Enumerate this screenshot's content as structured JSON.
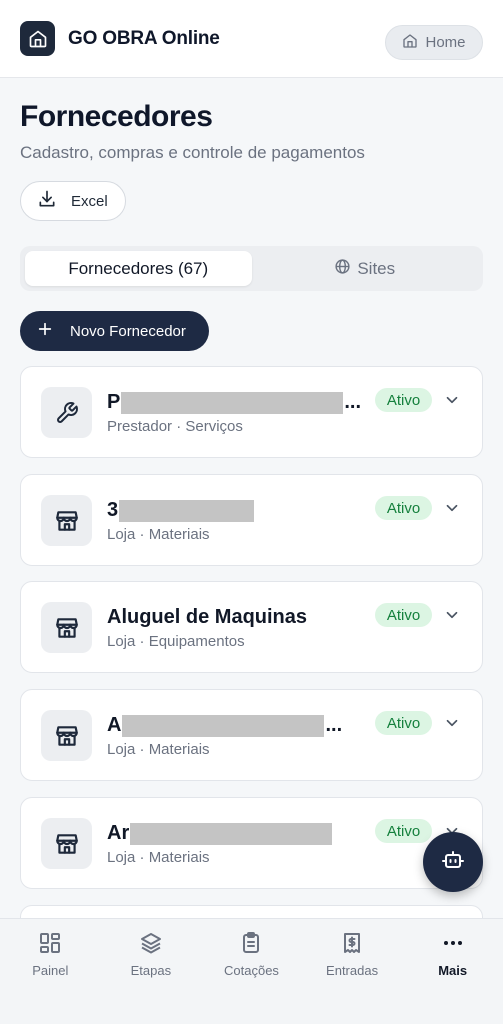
{
  "app": {
    "title": "GO OBRA Online"
  },
  "header": {
    "home_label": "Home"
  },
  "page": {
    "title": "Fornecedores",
    "subtitle": "Cadastro, compras e controle de pagamentos",
    "excel_label": "Excel",
    "new_label": "Novo Fornecedor"
  },
  "tabs": [
    {
      "label": "Fornecedores (67)",
      "active": true
    },
    {
      "label": "Sites",
      "active": false
    }
  ],
  "suppliers": [
    {
      "name": "P",
      "ellipsis": "...",
      "meta": "Prestador · Serviços",
      "status": "Ativo",
      "icon": "wrench-icon"
    },
    {
      "name": "3",
      "ellipsis": "",
      "meta": "Loja · Materiais",
      "status": "Ativo",
      "icon": "store-icon"
    },
    {
      "name": "Aluguel de Maquinas",
      "ellipsis": "",
      "meta": "Loja · Equipamentos",
      "status": "Ativo",
      "icon": "store-icon"
    },
    {
      "name": "A",
      "ellipsis": "...",
      "meta": "Loja · Materiais",
      "status": "Ativo",
      "icon": "store-icon"
    },
    {
      "name": "Ar",
      "ellipsis": "",
      "meta": "Loja · Materiais",
      "status": "Ativo",
      "icon": "store-icon"
    }
  ],
  "nav": [
    {
      "label": "Painel",
      "icon": "grid-icon"
    },
    {
      "label": "Etapas",
      "icon": "layers-icon"
    },
    {
      "label": "Cotações",
      "icon": "clipboard-icon"
    },
    {
      "label": "Entradas",
      "icon": "dollar-receipt-icon"
    },
    {
      "label": "Mais",
      "icon": "more-dots-icon",
      "active": true
    }
  ],
  "colors": {
    "primary": "#1e2a44",
    "badge_bg": "#dcf5e3",
    "badge_text": "#15803d"
  }
}
